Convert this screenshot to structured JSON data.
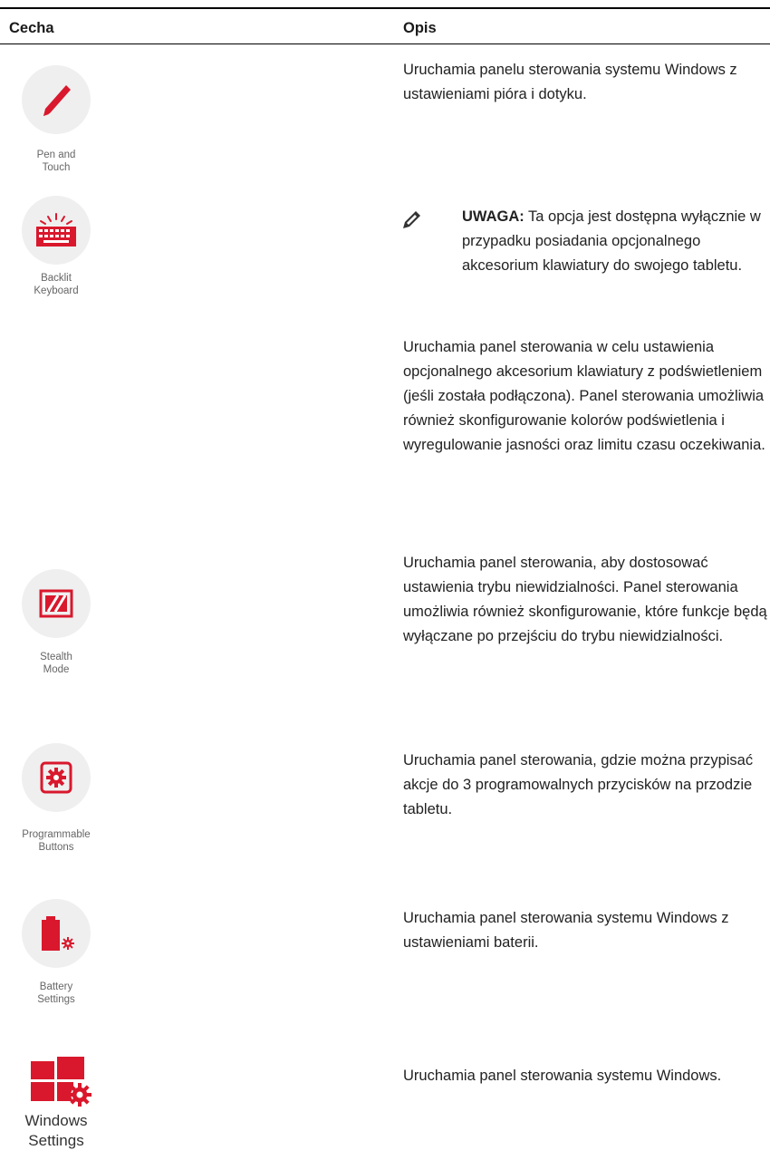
{
  "header": {
    "feature": "Cecha",
    "description": "Opis"
  },
  "rows": [
    {
      "icon": "pen-icon",
      "label": "Pen and Touch",
      "label_lines": [
        "Pen and",
        "Touch"
      ],
      "description": "Uruchamia panelu sterowania systemu Windows z ustawieniami pióra i dotyku."
    },
    {
      "icon": "backlit-keyboard-icon",
      "label": "Backlit Keyboard",
      "label_lines": [
        "Backlit",
        "Keyboard"
      ],
      "note_label": "UWAGA:",
      "note_text": " Ta opcja jest dostępna wyłącznie w przypadku posiadania opcjonalnego akcesorium klawiatury do swojego tabletu.",
      "description": "Uruchamia panel sterowania w celu ustawienia opcjonalnego akcesorium klawiatury z podświetleniem (jeśli została podłączona). Panel sterowania umożliwia również skonfigurowanie kolorów podświetlenia i wyregulowanie jasności oraz limitu czasu oczekiwania."
    },
    {
      "icon": "stealth-mode-icon",
      "label": "Stealth Mode",
      "label_lines": [
        "Stealth",
        "Mode"
      ],
      "description": "Uruchamia panel sterowania, aby dostosować ustawienia trybu niewidzialności. Panel sterowania umożliwia również skonfigurowanie, które funkcje będą wyłączane po przejściu do trybu niewidzialności."
    },
    {
      "icon": "programmable-buttons-icon",
      "label": "Programmable Buttons",
      "label_lines": [
        "Programmable",
        "Buttons"
      ],
      "description": "Uruchamia panel sterowania, gdzie można przypisać akcje do 3 programowalnych przycisków na przodzie tabletu."
    },
    {
      "icon": "battery-settings-icon",
      "label": "Battery Settings",
      "label_lines": [
        "Battery",
        "Settings"
      ],
      "description": "Uruchamia panel sterowania systemu Windows z ustawieniami baterii."
    },
    {
      "icon": "windows-settings-icon",
      "label": "Windows Settings",
      "label_lines": [
        "Windows",
        "Settings"
      ],
      "description": "Uruchamia panel sterowania systemu Windows."
    }
  ],
  "colors": {
    "accent": "#d9182d",
    "icon_bg": "#efefef",
    "text": "#222222"
  }
}
